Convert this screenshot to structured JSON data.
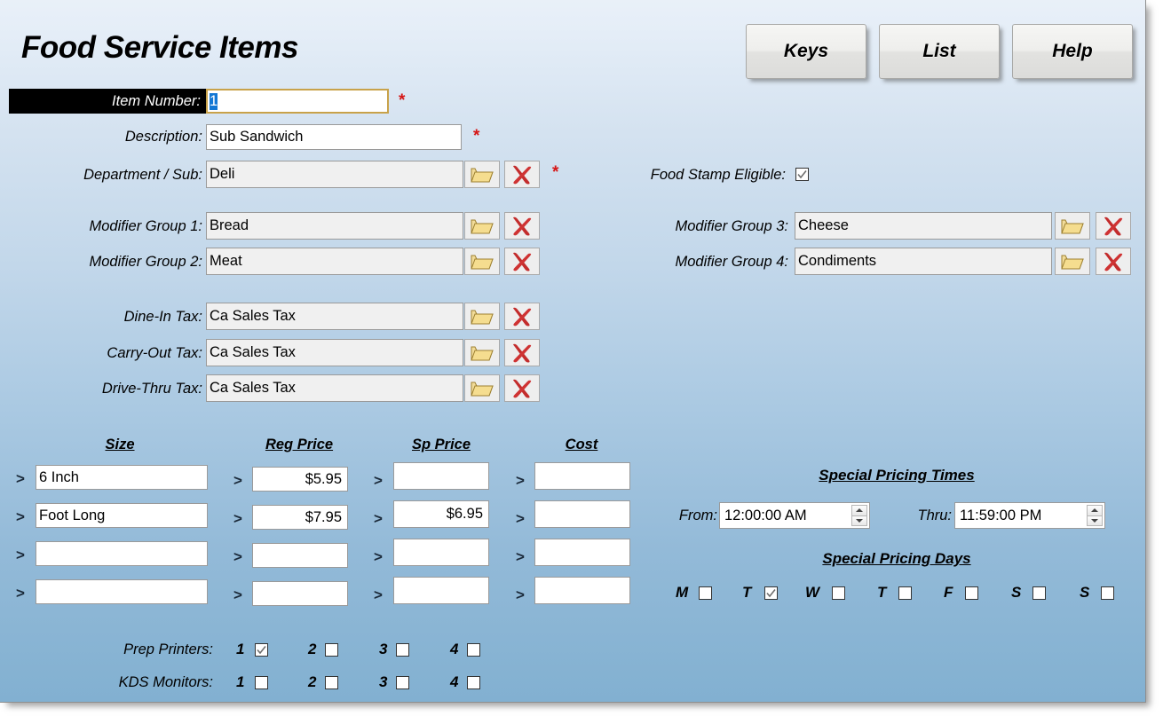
{
  "window": {
    "title": "Food Service Items"
  },
  "toolbar": {
    "keys_label": "Keys",
    "list_label": "List",
    "help_label": "Help"
  },
  "form": {
    "item_number": {
      "label": "Item Number:",
      "value": "1",
      "required_marker": "*"
    },
    "description": {
      "label": "Description:",
      "value": "Sub Sandwich",
      "required_marker": "*"
    },
    "department_sub": {
      "label": "Department / Sub:",
      "value": "Deli",
      "required_marker": "*"
    },
    "food_stamp_eligible": {
      "label": "Food Stamp Eligible:",
      "checked": true
    },
    "modifier_group_1": {
      "label": "Modifier Group 1:",
      "value": "Bread"
    },
    "modifier_group_2": {
      "label": "Modifier Group 2:",
      "value": "Meat"
    },
    "modifier_group_3": {
      "label": "Modifier Group 3:",
      "value": "Cheese"
    },
    "modifier_group_4": {
      "label": "Modifier Group 4:",
      "value": "Condiments"
    },
    "dine_in_tax": {
      "label": "Dine-In Tax:",
      "value": "Ca Sales Tax"
    },
    "carry_out_tax": {
      "label": "Carry-Out Tax:",
      "value": "Ca Sales Tax"
    },
    "drive_thru_tax": {
      "label": "Drive-Thru Tax:",
      "value": "Ca Sales Tax"
    }
  },
  "pricing_table": {
    "headers": {
      "size": "Size",
      "reg_price": "Reg Price",
      "sp_price": "Sp Price",
      "cost": "Cost"
    },
    "row_arrow": ">",
    "rows": [
      {
        "size": "6 Inch",
        "reg_price": "$5.95",
        "sp_price": "",
        "cost": ""
      },
      {
        "size": "Foot Long",
        "reg_price": "$7.95",
        "sp_price": "$6.95",
        "cost": ""
      },
      {
        "size": "",
        "reg_price": "",
        "sp_price": "",
        "cost": ""
      },
      {
        "size": "",
        "reg_price": "",
        "sp_price": "",
        "cost": ""
      }
    ]
  },
  "special_pricing": {
    "times_heading": "Special Pricing Times",
    "from_label": "From:",
    "from_value": "12:00:00 AM",
    "thru_label": "Thru:",
    "thru_value": "11:59:00 PM",
    "days_heading": "Special Pricing Days",
    "days": [
      {
        "label": "M",
        "checked": false
      },
      {
        "label": "T",
        "checked": true
      },
      {
        "label": "W",
        "checked": false
      },
      {
        "label": "T",
        "checked": false
      },
      {
        "label": "F",
        "checked": false
      },
      {
        "label": "S",
        "checked": false
      },
      {
        "label": "S",
        "checked": false
      }
    ]
  },
  "devices": {
    "prep_printers_label": "Prep Printers:",
    "prep_printers": [
      {
        "num": "1",
        "checked": true
      },
      {
        "num": "2",
        "checked": false
      },
      {
        "num": "3",
        "checked": false
      },
      {
        "num": "4",
        "checked": false
      }
    ],
    "kds_monitors_label": "KDS Monitors:",
    "kds_monitors": [
      {
        "num": "1",
        "checked": false
      },
      {
        "num": "2",
        "checked": false
      },
      {
        "num": "3",
        "checked": false
      },
      {
        "num": "4",
        "checked": false
      }
    ]
  },
  "colors": {
    "required_star": "#d51616",
    "selection": "#1277d4",
    "folder_icon": "#e8c86a",
    "delete_icon": "#c0252a"
  }
}
